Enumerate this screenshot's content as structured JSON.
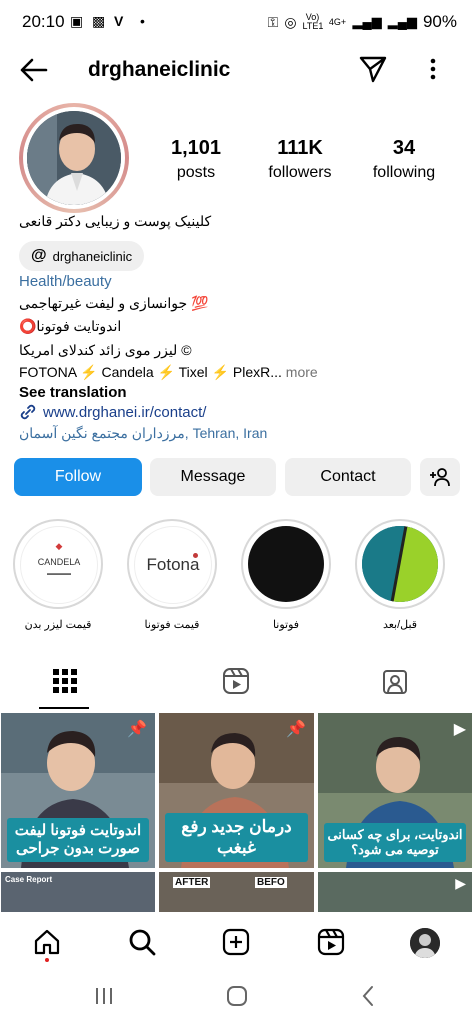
{
  "status_bar": {
    "time": "20:10",
    "network": "4G+",
    "carrier": "Vo) LTE1",
    "battery": "90%"
  },
  "header": {
    "username": "drghaneiclinic"
  },
  "stats": {
    "posts_count": "1,101",
    "posts_label": "posts",
    "followers_count": "111K",
    "followers_label": "followers",
    "following_count": "34",
    "following_label": "following"
  },
  "bio": {
    "name": "کلینیک پوست و زیبایی دکتر قانعی",
    "threads_handle": "drghaneiclinic",
    "category": "Health/beauty",
    "line1": "💯 جوانسازی و لیفت غیرتهاجمی",
    "line2": "اندوتایت فوتونا⭕",
    "line3": "© لیزر موی زائد کندلای امریکا",
    "brands": "FOTONA ⚡ Candela ⚡ Tixel ⚡ PlexR...",
    "more": "more",
    "see_translation": "See translation",
    "link": "www.drghanei.ir/contact/",
    "address": "مرزداران مجتمع نگین آسمان, Tehran, Iran"
  },
  "buttons": {
    "follow": "Follow",
    "message": "Message",
    "contact": "Contact"
  },
  "highlights": [
    {
      "caption": "قیمت لیزر بدن",
      "inner_text": "CANDELA"
    },
    {
      "caption": "قیمت فوتونا",
      "inner_text": "Fotona"
    },
    {
      "caption": "فوتونا",
      "inner_text": ""
    },
    {
      "caption": "قبل/بعد",
      "inner_text": ""
    }
  ],
  "grid_posts": [
    {
      "banner": "اندوتایت فوتونا لیفت صورت بدون جراحی"
    },
    {
      "banner": "درمان جدید رفع غبغب"
    },
    {
      "banner": "اندوتایت، برای چه کسانی توصیه می شود؟"
    }
  ],
  "grid_row2_labels": {
    "case_report": "Case Report",
    "after": "AFTER",
    "before": "BEFO"
  },
  "colors": {
    "follow_blue": "#1a8fe8",
    "link_blue": "#3b6fa0",
    "banner_teal": "#1a8fa0"
  }
}
